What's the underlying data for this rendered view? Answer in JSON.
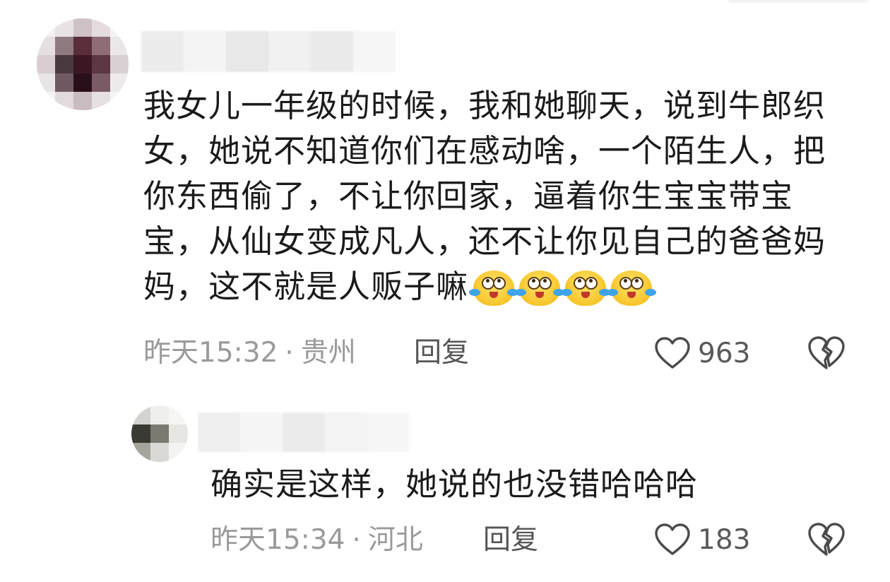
{
  "comments": [
    {
      "text": "我女儿一年级的时候，我和她聊天，说到牛郎织女，她说不知道你们在感动啥，一个陌生人，把你东西偷了，不让你回家，逼着你生宝宝带宝宝，从仙女变成凡人，还不让你见自己的爸爸妈妈，这不就是人贩子嘛",
      "emoji_count": 4,
      "emoji_name": "crying-laughing-face-icon",
      "time": "昨天15:32",
      "location": "贵州",
      "reply_label": "回复",
      "likes": "963"
    },
    {
      "text": "确实是这样，她说的也没错哈哈哈",
      "time": "昨天15:34",
      "location": "河北",
      "reply_label": "回复",
      "likes": "183"
    }
  ],
  "separator": "·",
  "colors": {
    "text": "#1b1b1b",
    "meta": "#9a9a9a",
    "reply": "#555555",
    "emoji_face": "#f7c52b",
    "emoji_tear": "#3fa3ea"
  }
}
